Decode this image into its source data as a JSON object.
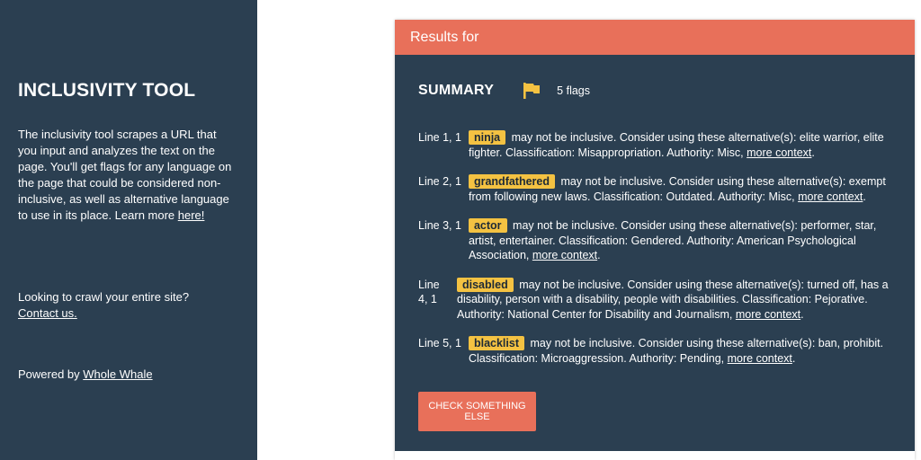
{
  "sidebar": {
    "title": "INCLUSIVITY TOOL",
    "description": "The inclusivity tool scrapes a URL that you input and analyzes the text on the page. You'll get flags for any language on the page that could be considered non-inclusive, as well as alternative language to use in its place. Learn more ",
    "learn_more_link": "here!",
    "crawl_text": "Looking to crawl your entire site?",
    "contact_link": "Contact us.",
    "powered_text": "Powered by ",
    "powered_link": "Whole Whale"
  },
  "results": {
    "header": "Results for",
    "summary_title": "SUMMARY",
    "flag_count": "5 flags",
    "flag_icon": "flag-icon",
    "flags": [
      {
        "line": "Line 1, 1",
        "word": "ninja",
        "text": "may not be inclusive. Consider using these alternative(s): elite warrior, elite fighter. Classification: Misappropriation. Authority: Misc,",
        "link": "more context"
      },
      {
        "line": "Line 2, 1",
        "word": "grandfathered",
        "text": "may not be inclusive. Consider using these alternative(s): exempt from following new laws. Classification: Outdated. Authority: Misc,",
        "link": "more context"
      },
      {
        "line": "Line 3, 1",
        "word": "actor",
        "text": "may not be inclusive. Consider using these alternative(s): performer, star, artist, entertainer. Classification: Gendered. Authority: American Psychological Association,",
        "link": "more context"
      },
      {
        "line": "Line 4, 1",
        "word": "disabled",
        "text": "may not be inclusive. Consider using these alternative(s): turned off, has a disability, person with a disability, people with disabilities. Classification: Pejorative. Authority: National Center for Disability and Journalism,",
        "link": "more context"
      },
      {
        "line": "Line 5, 1",
        "word": "blacklist",
        "text": "may not be inclusive. Consider using these alternative(s): ban, prohibit. Classification: Microaggression. Authority: Pending,",
        "link": "more context"
      }
    ],
    "check_button": "CHECK SOMETHING ELSE"
  },
  "colors": {
    "sidebar_bg": "#2b3f51",
    "accent": "#e8705a",
    "highlight": "#f4c242"
  }
}
